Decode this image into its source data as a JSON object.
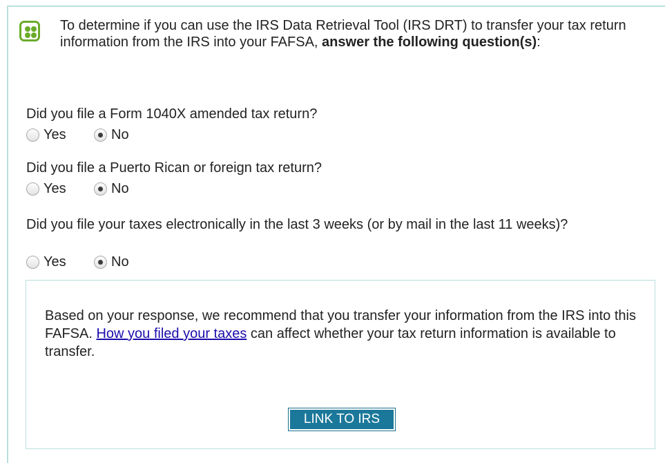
{
  "intro": {
    "text": "To determine if you can use the IRS Data Retrieval Tool (IRS DRT) to transfer your tax return information from the IRS into your FAFSA, ",
    "bold": "answer the following question(s)",
    "suffix": ":"
  },
  "questions": [
    {
      "label": "Did you file a Form 1040X amended tax return?",
      "yes": "Yes",
      "no": "No",
      "selected": "No"
    },
    {
      "label": "Did you file a Puerto Rican or foreign tax return?",
      "yes": "Yes",
      "no": "No",
      "selected": "No"
    },
    {
      "label": "Did you file your taxes electronically in the last 3 weeks (or by mail in the last 11 weeks)?",
      "yes": "Yes",
      "no": "No",
      "selected": "No"
    }
  ],
  "result": {
    "text_before": "Based on your response, we recommend that you transfer your information from the IRS into this FAFSA. ",
    "link": "How you filed your taxes",
    "text_after": " can affect whether your tax return information is available to transfer.",
    "button": "LINK TO IRS"
  },
  "colors": {
    "accent_green": "#6aab2a",
    "border_teal": "#b9dfdc",
    "button_blue": "#1b789a"
  }
}
